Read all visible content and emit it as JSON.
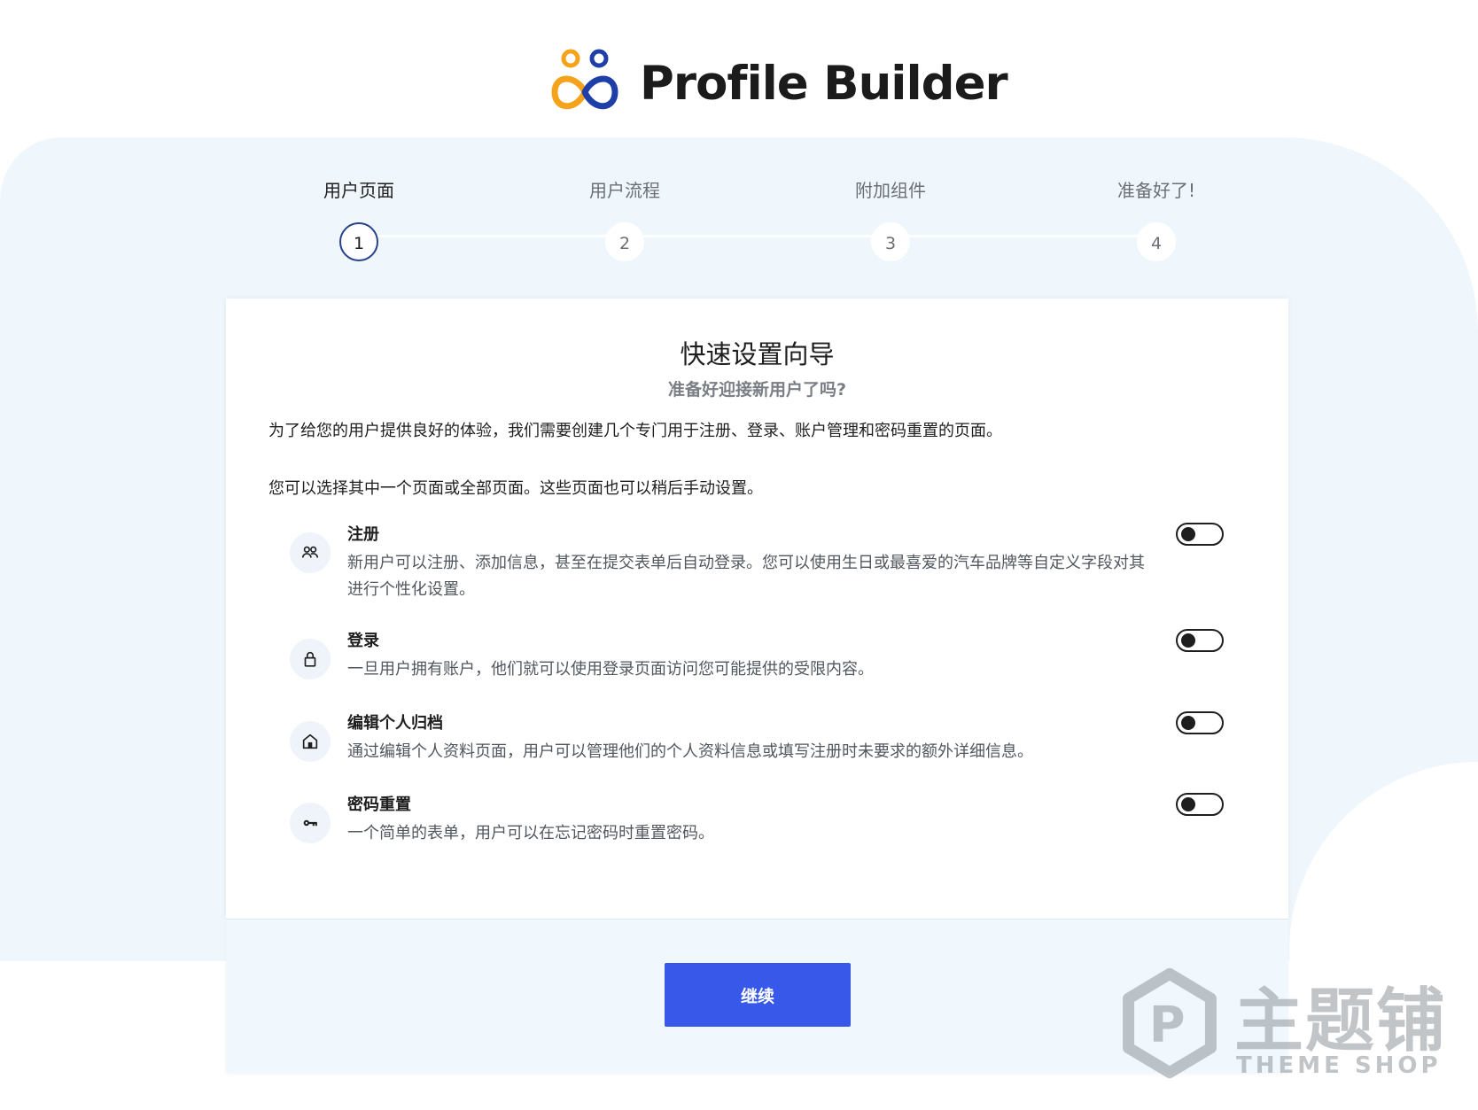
{
  "brand": {
    "name": "Profile Builder"
  },
  "steps": [
    {
      "label": "用户页面",
      "number": "1",
      "active": true
    },
    {
      "label": "用户流程",
      "number": "2",
      "active": false
    },
    {
      "label": "附加组件",
      "number": "3",
      "active": false
    },
    {
      "label": "准备好了!",
      "number": "4",
      "active": false
    }
  ],
  "card": {
    "title": "快速设置向导",
    "subtitle": "准备好迎接新用户了吗?",
    "intro1": "为了给您的用户提供良好的体验，我们需要创建几个专门用于注册、登录、账户管理和密码重置的页面。",
    "intro2": "您可以选择其中一个页面或全部页面。这些页面也可以稍后手动设置。",
    "options": [
      {
        "icon": "users-icon",
        "title": "注册",
        "desc": "新用户可以注册、添加信息，甚至在提交表单后自动登录。您可以使用生日或最喜爱的汽车品牌等自定义字段对其进行个性化设置。",
        "enabled": false
      },
      {
        "icon": "lock-icon",
        "title": "登录",
        "desc": "一旦用户拥有账户，他们就可以使用登录页面访问您可能提供的受限内容。",
        "enabled": false
      },
      {
        "icon": "home-icon",
        "title": "编辑个人归档",
        "desc": "通过编辑个人资料页面，用户可以管理他们的个人资料信息或填写注册时未要求的额外详细信息。",
        "enabled": false
      },
      {
        "icon": "key-icon",
        "title": "密码重置",
        "desc": "一个简单的表单，用户可以在忘记密码时重置密码。",
        "enabled": false
      }
    ]
  },
  "footer": {
    "continue_label": "继续"
  },
  "watermark": {
    "cn": "主题铺",
    "en": "THEME SHOP"
  },
  "colors": {
    "primary": "#3858e9",
    "active_step": "#27408b",
    "background": "#eff7fd"
  }
}
